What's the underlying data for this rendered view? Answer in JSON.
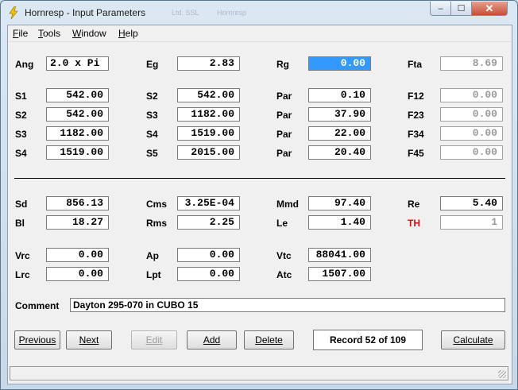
{
  "window": {
    "title": "Hornresp - Input Parameters",
    "ghost_title_1": "Ltd. SSL",
    "ghost_title_2": "Hornresp",
    "controls": {
      "minimize": "–",
      "maximize": "☐",
      "close": "✕"
    }
  },
  "icons": {
    "app": "lightning-bolt-icon"
  },
  "colors": {
    "selection": "#3399ff",
    "accent_label": "#d01010"
  },
  "menu": {
    "file": {
      "key": "F",
      "rest": "ile"
    },
    "tools": {
      "key": "T",
      "rest": "ools"
    },
    "window": {
      "key": "W",
      "rest": "indow"
    },
    "help": {
      "key": "H",
      "rest": "elp"
    }
  },
  "params": {
    "ang": {
      "label": "Ang",
      "value": "2.0 x Pi"
    },
    "eg": {
      "label": "Eg",
      "value": "2.83"
    },
    "rg": {
      "label": "Rg",
      "value": "0.00"
    },
    "fta": {
      "label": "Fta",
      "value": "8.69"
    },
    "row_s1": {
      "l1": "S1",
      "v1": "542.00",
      "l2": "S2",
      "v2": "542.00",
      "l3": "Par",
      "v3": "0.10",
      "l4": "F12",
      "v4": "0.00"
    },
    "row_s2": {
      "l1": "S2",
      "v1": "542.00",
      "l2": "S3",
      "v2": "1182.00",
      "l3": "Par",
      "v3": "37.90",
      "l4": "F23",
      "v4": "0.00"
    },
    "row_s3": {
      "l1": "S3",
      "v1": "1182.00",
      "l2": "S4",
      "v2": "1519.00",
      "l3": "Par",
      "v3": "22.00",
      "l4": "F34",
      "v4": "0.00"
    },
    "row_s4": {
      "l1": "S4",
      "v1": "1519.00",
      "l2": "S5",
      "v2": "2015.00",
      "l3": "Par",
      "v3": "20.40",
      "l4": "F45",
      "v4": "0.00"
    },
    "sd": {
      "label": "Sd",
      "value": "856.13"
    },
    "cms": {
      "label": "Cms",
      "value": "3.25E-04"
    },
    "mmd": {
      "label": "Mmd",
      "value": "97.40"
    },
    "re": {
      "label": "Re",
      "value": "5.40"
    },
    "bl": {
      "label": "Bl",
      "value": "18.27"
    },
    "rms": {
      "label": "Rms",
      "value": "2.25"
    },
    "le": {
      "label": "Le",
      "value": "1.40"
    },
    "th": {
      "label": "TH",
      "value": "1"
    },
    "vrc": {
      "label": "Vrc",
      "value": "0.00"
    },
    "ap": {
      "label": "Ap",
      "value": "0.00"
    },
    "vtc": {
      "label": "Vtc",
      "value": "88041.00"
    },
    "lrc": {
      "label": "Lrc",
      "value": "0.00"
    },
    "lpt": {
      "label": "Lpt",
      "value": "0.00"
    },
    "atc": {
      "label": "Atc",
      "value": "1507.00"
    }
  },
  "comment": {
    "label": "Comment",
    "value": "Dayton 295-070 in CUBO 15"
  },
  "buttons": {
    "previous": "Previous",
    "next": "Next",
    "edit": "Edit",
    "add": "Add",
    "delete": "Delete",
    "calculate": "Calculate"
  },
  "record": "Record 52 of 109"
}
